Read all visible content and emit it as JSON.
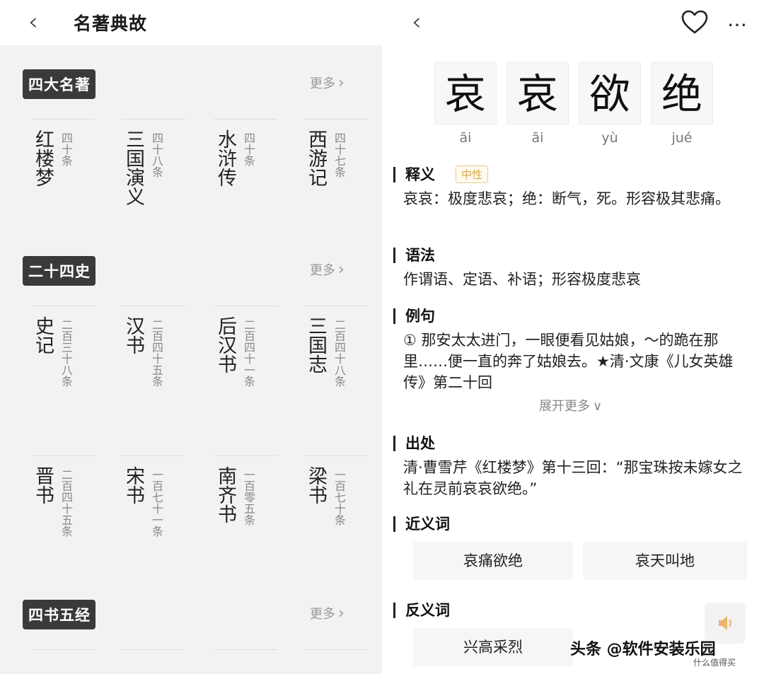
{
  "left": {
    "back_icon": "chevron-left-icon",
    "title": "名著典故",
    "sections": [
      {
        "tag": "四大名著",
        "more": "更多",
        "books": [
          {
            "name": "红楼梦",
            "count": "四十条"
          },
          {
            "name": "三国演义",
            "count": "四十八条"
          },
          {
            "name": "水浒传",
            "count": "四十条"
          },
          {
            "name": "西游记",
            "count": "四十七条"
          }
        ]
      },
      {
        "tag": "二十四史",
        "more": "更多",
        "books": [
          {
            "name": "史记",
            "count": "二百三十八条"
          },
          {
            "name": "汉书",
            "count": "二百四十五条"
          },
          {
            "name": "后汉书",
            "count": "二百四十一条"
          },
          {
            "name": "三国志",
            "count": "二百四十八条"
          },
          {
            "name": "晋书",
            "count": "二百四十五条"
          },
          {
            "name": "宋书",
            "count": "一百七十一条"
          },
          {
            "name": "南齐书",
            "count": "一百零五条"
          },
          {
            "name": "梁书",
            "count": "一百七十条"
          }
        ]
      },
      {
        "tag": "四书五经",
        "more": "更多",
        "books": []
      }
    ]
  },
  "right": {
    "back_icon": "chevron-left-icon",
    "heart_icon": "heart-icon",
    "more_icon": "more-dots-icon",
    "characters": [
      {
        "char": "哀",
        "pinyin": "āi"
      },
      {
        "char": "哀",
        "pinyin": "āi"
      },
      {
        "char": "欲",
        "pinyin": "yù"
      },
      {
        "char": "绝",
        "pinyin": "jué"
      }
    ],
    "meaning": {
      "title": "释义",
      "badge": "中性",
      "text": "哀哀：极度悲哀；绝：断气，死。形容极其悲痛。"
    },
    "grammar": {
      "title": "语法",
      "text": "作谓语、定语、补语；形容极度悲哀"
    },
    "example": {
      "title": "例句",
      "text": "① 那安太太进门，一眼便看见姑娘，～的跪在那里……便一直的奔了姑娘去。★清·文康《儿女英雄传》第二十回",
      "expand": "展开更多"
    },
    "source": {
      "title": "出处",
      "text": "清·曹雪芹《红楼梦》第十三回：“那宝珠按未嫁女之礼在灵前哀哀欲绝。”"
    },
    "synonyms": {
      "title": "近义词",
      "items": [
        "哀痛欲绝",
        "哀天叫地"
      ]
    },
    "antonyms": {
      "title": "反义词",
      "items": [
        "兴高采烈"
      ]
    },
    "speaker_icon": "speaker-icon"
  },
  "watermark": {
    "main": "头条 @软件安装乐园",
    "corner": "什么值得买"
  }
}
